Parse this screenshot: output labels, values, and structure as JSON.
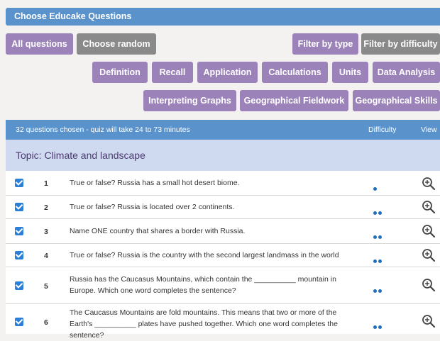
{
  "header": {
    "title": "Choose Educake Questions"
  },
  "row1_buttons": {
    "all_questions": "All questions",
    "choose_random": "Choose random",
    "filter_type": "Filter by type",
    "filter_difficulty": "Filter by difficulty"
  },
  "type_filters": [
    "Definition",
    "Recall",
    "Application",
    "Calculations",
    "Units",
    "Data Analysis",
    "Interpreting Graphs",
    "Geographical Fieldwork",
    "Geographical Skills"
  ],
  "table": {
    "summary": "32 questions chosen - quiz will take 24 to 73 minutes",
    "col_difficulty": "Difficulty",
    "col_view": "View",
    "topic": "Topic: Climate and landscape",
    "rows": [
      {
        "num": "1",
        "text": "True or false? Russia has a small hot desert biome.",
        "difficulty": 1,
        "checked": true
      },
      {
        "num": "2",
        "text": "True or false? Russia is located over 2 continents.",
        "difficulty": 2,
        "checked": true
      },
      {
        "num": "3",
        "text": "Name ONE country that shares a border with Russia.",
        "difficulty": 2,
        "checked": true
      },
      {
        "num": "4",
        "text": "True or false? Russia is the country with the second largest landmass in the world",
        "difficulty": 2,
        "checked": true
      },
      {
        "num": "5",
        "text": "Russia has the Caucasus Mountains, which contain the __________ mountain in Europe. Which one word completes the sentence?",
        "difficulty": 2,
        "checked": true
      },
      {
        "num": "6",
        "text": "The Caucasus Mountains are fold mountains. This means that two or more of the Earth's __________ plates have pushed together. Which one word completes the sentence?",
        "difficulty": 2,
        "checked": true
      }
    ]
  },
  "colors": {
    "header_blue": "#5a93cc",
    "button_purple": "#9b82b8",
    "button_grey": "#8a8a8a",
    "topic_bg": "#cfdaf0",
    "checkbox_blue": "#2c7fd6"
  },
  "icons": {
    "view": "zoom-in-magnifier-icon",
    "check": "checkbox-checked-icon"
  }
}
